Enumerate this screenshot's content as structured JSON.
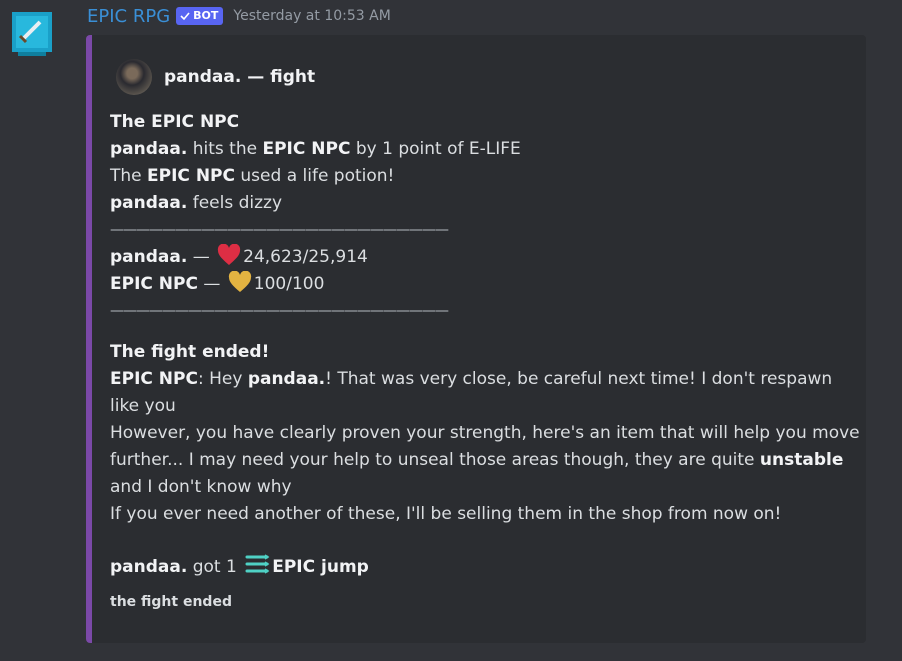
{
  "message": {
    "username": "EPIC RPG",
    "bot_tag": "BOT",
    "timestamp": "Yesterday at 10:53 AM"
  },
  "embed": {
    "accent_color": "#7b49a8",
    "author": "pandaa. — fight",
    "title": "The EPIC NPC",
    "lines": {
      "l1_a": "pandaa.",
      "l1_b": " hits the ",
      "l1_c": "EPIC NPC",
      "l1_d": " by 1 point of E-LIFE",
      "l2_a": "The ",
      "l2_b": "EPIC NPC",
      "l2_c": " used a life potion!",
      "l3_a": "pandaa.",
      "l3_b": " feels dizzy"
    },
    "separator": "——————————————————————————",
    "player": {
      "name": "pandaa.",
      "dash": " — ",
      "hp": "24,623/25,914",
      "heart_color": "#dd2e44"
    },
    "npc": {
      "name": "EPIC NPC",
      "dash": " — ",
      "hp": "100/100",
      "heart_color": "#fdcb58"
    },
    "fight_ended_title": "The fight ended!",
    "dialogue": {
      "speaker": "EPIC NPC",
      "p1_a": ": Hey ",
      "p1_b": "pandaa.",
      "p1_c": "! That was very close, be careful next time! I don't respawn like you",
      "p2_a": "However, you have clearly proven your strength, here's an item that will help you move further... I may need your help to unseal those areas though, they are quite ",
      "p2_b": "unstable",
      "p2_c": " and I don't know why",
      "p3": "If you ever need another of these, I'll be selling them in the shop from now on!"
    },
    "reward": {
      "name": "pandaa.",
      "text": " got 1 ",
      "item": "EPIC jump",
      "icon": "epic-jump-icon"
    },
    "footer": "the fight ended"
  }
}
